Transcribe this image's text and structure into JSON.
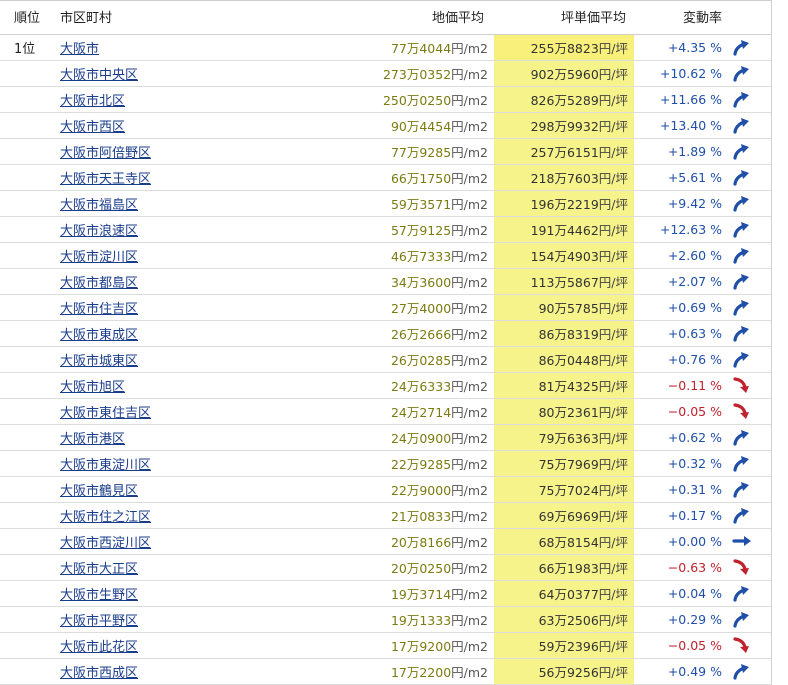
{
  "header": {
    "rank": "順位",
    "city": "市区町村",
    "land_price": "地価平均",
    "tsubo_price": "坪単価平均",
    "change_rate": "変動率"
  },
  "colors": {
    "link": "#1a3d8c",
    "land_text": "#7b7b12",
    "tsubo_bg": "#f6f38a",
    "up": "#1f4fa8",
    "down": "#c0222e"
  },
  "rows": [
    {
      "rank": "1位",
      "city": "大阪市",
      "land": "77万4044",
      "land_unit": "円/m2",
      "tsubo": "255万8823",
      "tsubo_unit": "円/坪",
      "rate": "+4.35 %",
      "trend": "up"
    },
    {
      "rank": "",
      "city": "大阪市中央区",
      "land": "273万0352",
      "land_unit": "円/m2",
      "tsubo": "902万5960",
      "tsubo_unit": "円/坪",
      "rate": "+10.62 %",
      "trend": "up"
    },
    {
      "rank": "",
      "city": "大阪市北区",
      "land": "250万0250",
      "land_unit": "円/m2",
      "tsubo": "826万5289",
      "tsubo_unit": "円/坪",
      "rate": "+11.66 %",
      "trend": "up"
    },
    {
      "rank": "",
      "city": "大阪市西区",
      "land": "90万4454",
      "land_unit": "円/m2",
      "tsubo": "298万9932",
      "tsubo_unit": "円/坪",
      "rate": "+13.40 %",
      "trend": "up"
    },
    {
      "rank": "",
      "city": "大阪市阿倍野区",
      "land": "77万9285",
      "land_unit": "円/m2",
      "tsubo": "257万6151",
      "tsubo_unit": "円/坪",
      "rate": "+1.89 %",
      "trend": "up"
    },
    {
      "rank": "",
      "city": "大阪市天王寺区",
      "land": "66万1750",
      "land_unit": "円/m2",
      "tsubo": "218万7603",
      "tsubo_unit": "円/坪",
      "rate": "+5.61 %",
      "trend": "up"
    },
    {
      "rank": "",
      "city": "大阪市福島区",
      "land": "59万3571",
      "land_unit": "円/m2",
      "tsubo": "196万2219",
      "tsubo_unit": "円/坪",
      "rate": "+9.42 %",
      "trend": "up"
    },
    {
      "rank": "",
      "city": "大阪市浪速区",
      "land": "57万9125",
      "land_unit": "円/m2",
      "tsubo": "191万4462",
      "tsubo_unit": "円/坪",
      "rate": "+12.63 %",
      "trend": "up"
    },
    {
      "rank": "",
      "city": "大阪市淀川区",
      "land": "46万7333",
      "land_unit": "円/m2",
      "tsubo": "154万4903",
      "tsubo_unit": "円/坪",
      "rate": "+2.60 %",
      "trend": "up"
    },
    {
      "rank": "",
      "city": "大阪市都島区",
      "land": "34万3600",
      "land_unit": "円/m2",
      "tsubo": "113万5867",
      "tsubo_unit": "円/坪",
      "rate": "+2.07 %",
      "trend": "up"
    },
    {
      "rank": "",
      "city": "大阪市住吉区",
      "land": "27万4000",
      "land_unit": "円/m2",
      "tsubo": "90万5785",
      "tsubo_unit": "円/坪",
      "rate": "+0.69 %",
      "trend": "up"
    },
    {
      "rank": "",
      "city": "大阪市東成区",
      "land": "26万2666",
      "land_unit": "円/m2",
      "tsubo": "86万8319",
      "tsubo_unit": "円/坪",
      "rate": "+0.63 %",
      "trend": "up"
    },
    {
      "rank": "",
      "city": "大阪市城東区",
      "land": "26万0285",
      "land_unit": "円/m2",
      "tsubo": "86万0448",
      "tsubo_unit": "円/坪",
      "rate": "+0.76 %",
      "trend": "up"
    },
    {
      "rank": "",
      "city": "大阪市旭区",
      "land": "24万6333",
      "land_unit": "円/m2",
      "tsubo": "81万4325",
      "tsubo_unit": "円/坪",
      "rate": "−0.11 %",
      "trend": "down"
    },
    {
      "rank": "",
      "city": "大阪市東住吉区",
      "land": "24万2714",
      "land_unit": "円/m2",
      "tsubo": "80万2361",
      "tsubo_unit": "円/坪",
      "rate": "−0.05 %",
      "trend": "down"
    },
    {
      "rank": "",
      "city": "大阪市港区",
      "land": "24万0900",
      "land_unit": "円/m2",
      "tsubo": "79万6363",
      "tsubo_unit": "円/坪",
      "rate": "+0.62 %",
      "trend": "up"
    },
    {
      "rank": "",
      "city": "大阪市東淀川区",
      "land": "22万9285",
      "land_unit": "円/m2",
      "tsubo": "75万7969",
      "tsubo_unit": "円/坪",
      "rate": "+0.32 %",
      "trend": "up"
    },
    {
      "rank": "",
      "city": "大阪市鶴見区",
      "land": "22万9000",
      "land_unit": "円/m2",
      "tsubo": "75万7024",
      "tsubo_unit": "円/坪",
      "rate": "+0.31 %",
      "trend": "up"
    },
    {
      "rank": "",
      "city": "大阪市住之江区",
      "land": "21万0833",
      "land_unit": "円/m2",
      "tsubo": "69万6969",
      "tsubo_unit": "円/坪",
      "rate": "+0.17 %",
      "trend": "up"
    },
    {
      "rank": "",
      "city": "大阪市西淀川区",
      "land": "20万8166",
      "land_unit": "円/m2",
      "tsubo": "68万8154",
      "tsubo_unit": "円/坪",
      "rate": "+0.00 %",
      "trend": "flat"
    },
    {
      "rank": "",
      "city": "大阪市大正区",
      "land": "20万0250",
      "land_unit": "円/m2",
      "tsubo": "66万1983",
      "tsubo_unit": "円/坪",
      "rate": "−0.63 %",
      "trend": "down"
    },
    {
      "rank": "",
      "city": "大阪市生野区",
      "land": "19万3714",
      "land_unit": "円/m2",
      "tsubo": "64万0377",
      "tsubo_unit": "円/坪",
      "rate": "+0.04 %",
      "trend": "up"
    },
    {
      "rank": "",
      "city": "大阪市平野区",
      "land": "19万1333",
      "land_unit": "円/m2",
      "tsubo": "63万2506",
      "tsubo_unit": "円/坪",
      "rate": "+0.29 %",
      "trend": "up"
    },
    {
      "rank": "",
      "city": "大阪市此花区",
      "land": "17万9200",
      "land_unit": "円/m2",
      "tsubo": "59万2396",
      "tsubo_unit": "円/坪",
      "rate": "−0.05 %",
      "trend": "down"
    },
    {
      "rank": "",
      "city": "大阪市西成区",
      "land": "17万2200",
      "land_unit": "円/m2",
      "tsubo": "56万9256",
      "tsubo_unit": "円/坪",
      "rate": "+0.49 %",
      "trend": "up"
    }
  ]
}
